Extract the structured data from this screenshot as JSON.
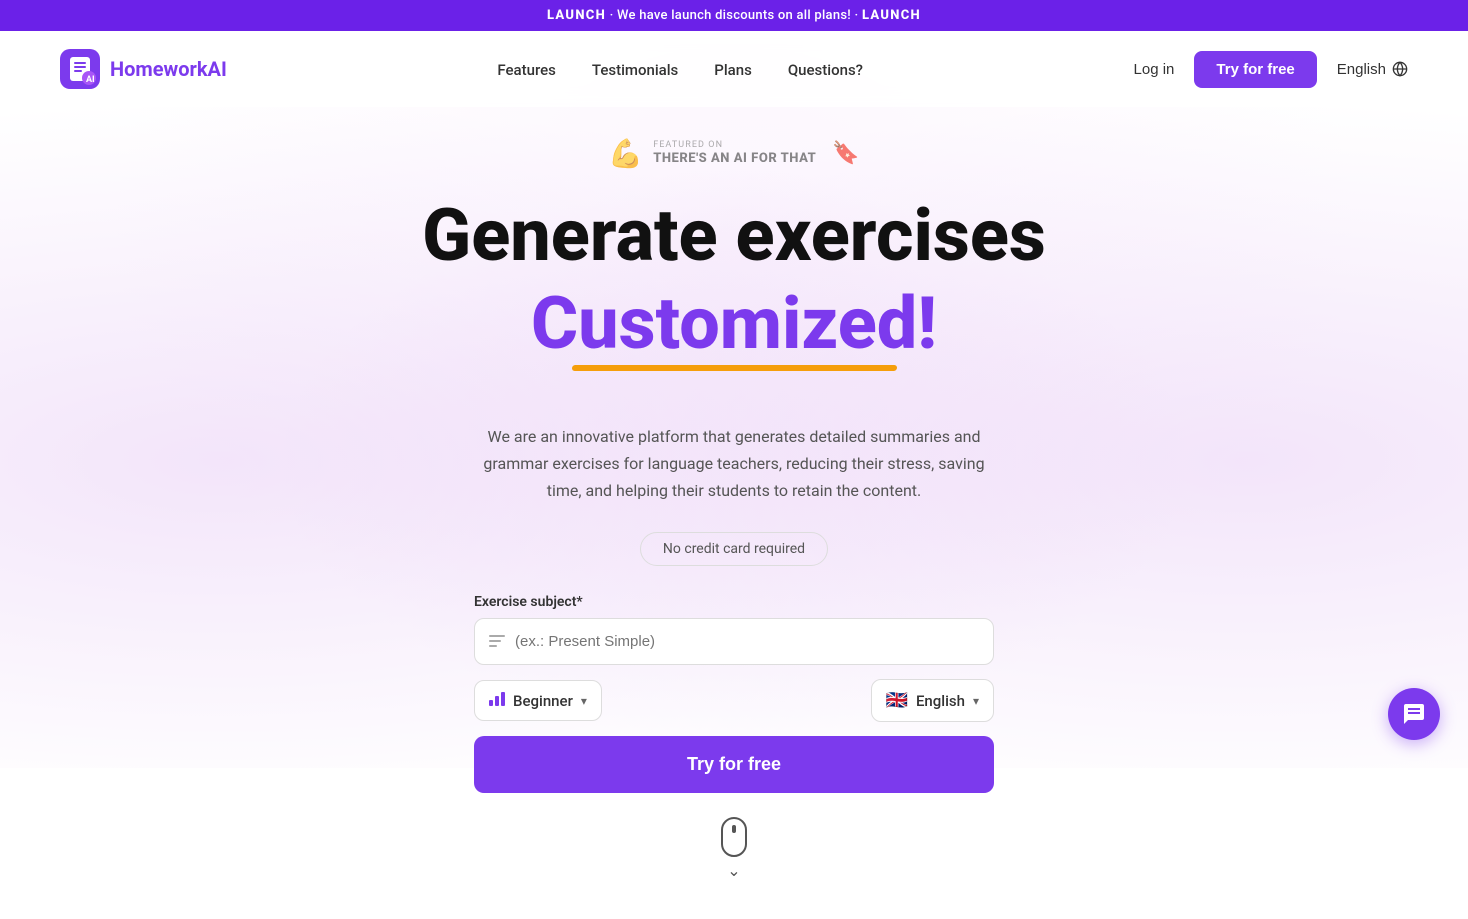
{
  "banner": {
    "launch1": "LAUNCH",
    "separator1": "·",
    "middle": "We have launch discounts on all plans!",
    "separator2": "·",
    "launch2": "LAUNCH"
  },
  "nav": {
    "logo_text_normal": "Homework",
    "logo_text_colored": "AI",
    "links": [
      {
        "label": "Features",
        "href": "#"
      },
      {
        "label": "Testimonials",
        "href": "#"
      },
      {
        "label": "Plans",
        "href": "#"
      },
      {
        "label": "Questions?",
        "href": "#"
      }
    ],
    "login_label": "Log in",
    "try_label": "Try for free",
    "lang_label": "English"
  },
  "hero": {
    "featured_on_small": "FEATURED ON",
    "featured_on_name": "THERE'S AN AI FOR THAT",
    "title_line1": "Generate exercises",
    "title_line2": "Customized!",
    "description": "We are an innovative platform that generates detailed summaries and grammar exercises for language teachers, reducing their stress, saving time, and helping their students to retain the content.",
    "no_cc": "No credit card required",
    "form_label": "Exercise subject*",
    "input_placeholder": "(ex.: Present Simple)",
    "level_label": "Beginner",
    "lang_select_label": "English",
    "try_btn_label": "Try for free"
  }
}
